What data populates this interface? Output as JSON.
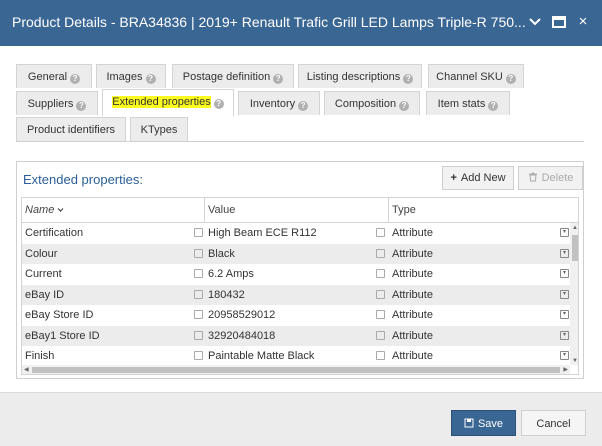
{
  "window": {
    "title": "Product Details - BRA34836 | 2019+ Renault Trafic Grill LED Lamps Triple-R 750...",
    "minimize_icon": "chevron-down-icon",
    "maximize_icon": "maximize-icon",
    "close_icon": "close-icon",
    "close_glyph": "×"
  },
  "tabs": {
    "row1": [
      {
        "label": "General"
      },
      {
        "label": "Images"
      },
      {
        "label": "Postage definition"
      },
      {
        "label": "Listing descriptions"
      },
      {
        "label": "Channel SKU"
      }
    ],
    "row2": [
      {
        "label": "Suppliers"
      },
      {
        "label": "Extended properties",
        "active": true
      },
      {
        "label": "Inventory"
      },
      {
        "label": "Composition"
      },
      {
        "label": "Item stats"
      }
    ],
    "row3": [
      {
        "label": "Product identifiers"
      },
      {
        "label": "KTypes"
      }
    ],
    "help_glyph": "?"
  },
  "panel": {
    "title": "Extended properties:",
    "add_label": "Add New",
    "delete_label": "Delete"
  },
  "grid": {
    "headers": {
      "name": "Name",
      "value": "Value",
      "type": "Type"
    },
    "rows": [
      {
        "name": "Certification",
        "value": "High Beam ECE R112",
        "type": "Attribute"
      },
      {
        "name": "Colour",
        "value": "Black",
        "type": "Attribute"
      },
      {
        "name": "Current",
        "value": "6.2 Amps",
        "type": "Attribute"
      },
      {
        "name": "eBay ID",
        "value": "180432",
        "type": "Attribute"
      },
      {
        "name": "eBay Store ID",
        "value": "20958529012",
        "type": "Attribute"
      },
      {
        "name": "eBay1 Store ID",
        "value": "32920484018",
        "type": "Attribute"
      },
      {
        "name": "Finish",
        "value": "Paintable Matte Black",
        "type": "Attribute"
      }
    ]
  },
  "footer": {
    "save_label": "Save",
    "cancel_label": "Cancel"
  },
  "colors": {
    "titlebar": "#3a6694",
    "accent": "#2a5f98",
    "highlight": "#fcfc1e",
    "save_button": "#3a6694"
  }
}
